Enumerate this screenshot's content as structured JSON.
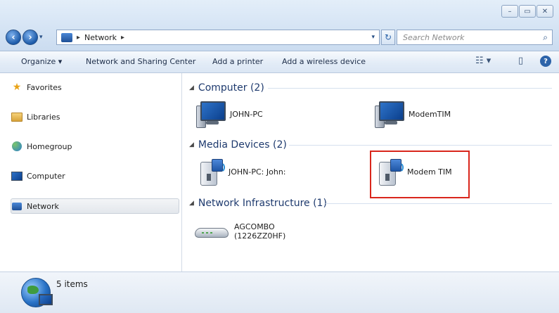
{
  "window": {
    "buttons": [
      "–",
      "▭",
      "✕"
    ]
  },
  "address_bar": {
    "path_root_chevron": "▸",
    "path_item": "Network",
    "path_chevron": "▸",
    "dropdown_arrow": "▾",
    "refresh_glyph": "↻",
    "search_placeholder": "Search Network",
    "search_glyph": "⌕"
  },
  "toolbar": {
    "organize": "Organize ▾",
    "network_sharing": "Network and Sharing Center",
    "add_printer": "Add a printer",
    "add_wireless": "Add a wireless device",
    "view_glyph": "☷ ▾",
    "pane_glyph": "▯",
    "help_glyph": "?"
  },
  "sidebar": {
    "items": [
      {
        "label": "Favorites",
        "icon": "star-icon"
      },
      {
        "label": "Libraries",
        "icon": "libraries-icon"
      },
      {
        "label": "Homegroup",
        "icon": "homegroup-icon"
      },
      {
        "label": "Computer",
        "icon": "computer-icon"
      },
      {
        "label": "Network",
        "icon": "network-icon",
        "selected": true
      }
    ]
  },
  "groups": [
    {
      "title": "Computer (2)",
      "items": [
        {
          "label": "JOHN-PC",
          "icon": "computer-icon"
        },
        {
          "label": "ModemTIM",
          "icon": "computer-icon"
        }
      ]
    },
    {
      "title": "Media Devices (2)",
      "items": [
        {
          "label": "JOHN-PC: John:",
          "icon": "media-device-icon"
        },
        {
          "label": "Modem TIM",
          "icon": "media-device-icon"
        }
      ]
    },
    {
      "title": "Network Infrastructure (1)",
      "items": [
        {
          "label_line1": "AGCOMBO",
          "label_line2": "(1226ZZ0HF)",
          "icon": "router-icon"
        }
      ]
    }
  ],
  "status": {
    "count": "5 items"
  },
  "colors": {
    "highlight": "#d9261c",
    "group_header": "#1e3a6e",
    "chrome": "#d4e3f4"
  }
}
